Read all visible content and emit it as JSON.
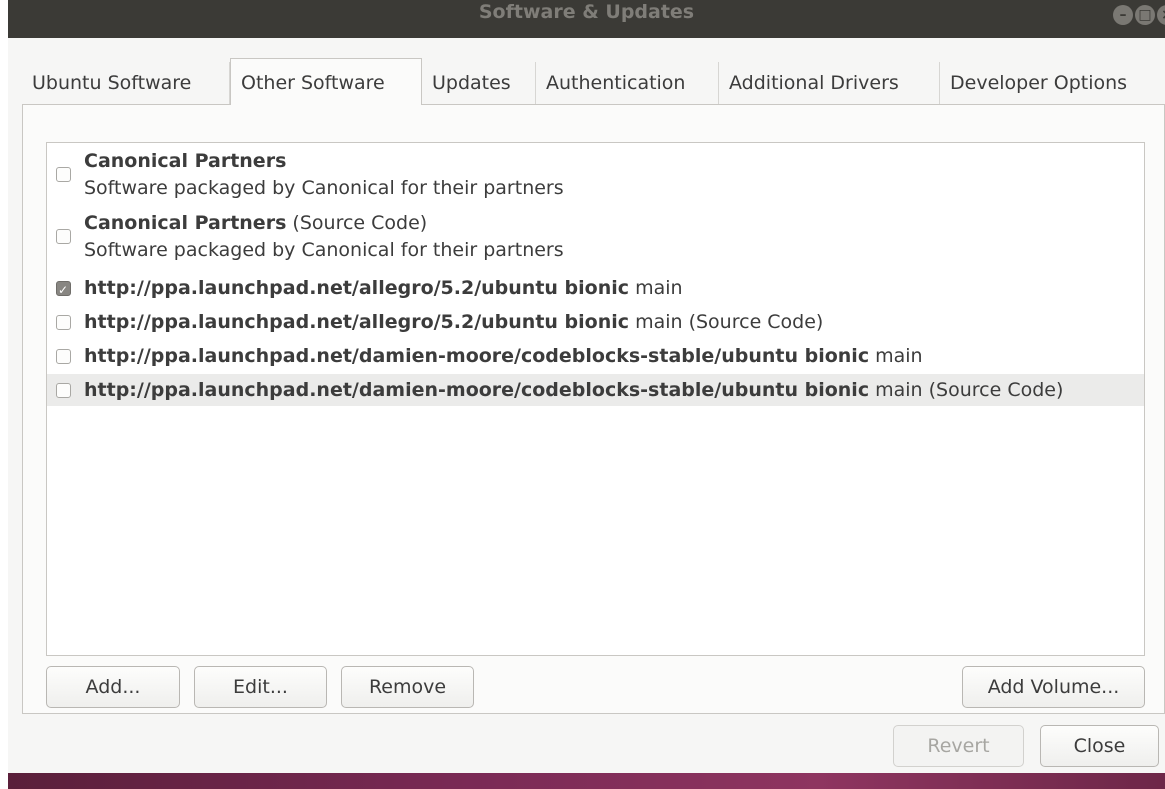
{
  "window": {
    "title": "Software & Updates"
  },
  "tabs": [
    {
      "label": "Ubuntu Software"
    },
    {
      "label": "Other Software"
    },
    {
      "label": "Updates"
    },
    {
      "label": "Authentication"
    },
    {
      "label": "Additional Drivers"
    },
    {
      "label": "Developer Options"
    }
  ],
  "sources": {
    "items": [
      {
        "bold": "Canonical Partners",
        "rest": "",
        "subtitle": "Software packaged by Canonical for their partners",
        "checked": false
      },
      {
        "bold": "Canonical Partners",
        "rest": " (Source Code)",
        "subtitle": "Software packaged by Canonical for their partners",
        "checked": false
      },
      {
        "bold": "http://ppa.launchpad.net/allegro/5.2/ubuntu bionic",
        "rest": " main",
        "checked": true
      },
      {
        "bold": "http://ppa.launchpad.net/allegro/5.2/ubuntu bionic",
        "rest": " main (Source Code)",
        "checked": false
      },
      {
        "bold": "http://ppa.launchpad.net/damien-moore/codeblocks-stable/ubuntu bionic",
        "rest": " main",
        "checked": false
      },
      {
        "bold": "http://ppa.launchpad.net/damien-moore/codeblocks-stable/ubuntu bionic",
        "rest": " main (Source Code)",
        "checked": false
      }
    ]
  },
  "buttons": {
    "add": "Add...",
    "edit": "Edit...",
    "remove": "Remove",
    "add_volume": "Add Volume...",
    "revert": "Revert",
    "close": "Close"
  }
}
